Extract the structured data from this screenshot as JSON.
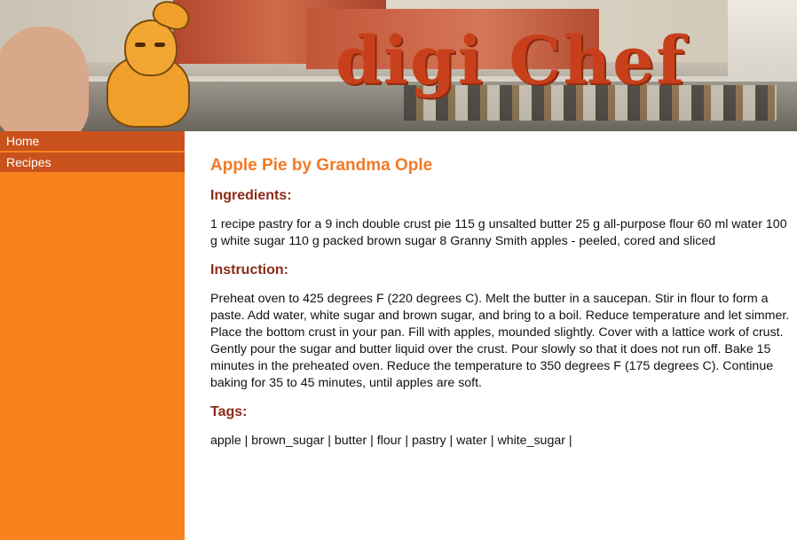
{
  "banner": {
    "logo_text": "digi Chef"
  },
  "sidebar": {
    "items": [
      {
        "label": "Home"
      },
      {
        "label": "Recipes"
      }
    ]
  },
  "recipe": {
    "title": "Apple Pie by Grandma Ople",
    "ingredients_heading": "Ingredients:",
    "ingredients_text": "1 recipe pastry for a 9 inch double crust pie 115 g unsalted butter 25 g all-purpose flour 60 ml water 100 g white sugar 110 g packed brown sugar 8 Granny Smith apples - peeled, cored and sliced",
    "instruction_heading": "Instruction:",
    "instruction_text": "Preheat oven to 425 degrees F (220 degrees C). Melt the butter in a saucepan. Stir in flour to form a paste. Add water, white sugar and brown sugar, and bring to a boil. Reduce temperature and let simmer. Place the bottom crust in your pan. Fill with apples, mounded slightly. Cover with a lattice work of crust. Gently pour the sugar and butter liquid over the crust. Pour slowly so that it does not run off. Bake 15 minutes in the preheated oven. Reduce the temperature to 350 degrees F (175 degrees C). Continue baking for 35 to 45 minutes, until apples are soft.",
    "tags_heading": "Tags:",
    "tags": [
      "apple",
      "brown_sugar",
      "butter",
      "flour",
      "pastry",
      "water",
      "white_sugar"
    ],
    "tag_separator": " | "
  },
  "colors": {
    "sidebar_bg": "#f8821e",
    "nav_item_bg": "#c9521c",
    "title_color": "#f07a28",
    "heading_color": "#8a2b1a",
    "logo_color": "#c8401b"
  },
  "icons": {
    "mascot": "chef-mascot-illustration"
  }
}
